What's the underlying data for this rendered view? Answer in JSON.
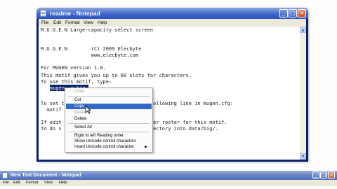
{
  "window": {
    "title": "readme - Notepad",
    "min_label": "_",
    "max_label": "□",
    "close_label": "×"
  },
  "menu": [
    "File",
    "Edit",
    "Format",
    "View",
    "Help"
  ],
  "editor": {
    "lines": [
      "M.U.G.E.N Large-capacity select screen",
      "",
      "M.U.G.E.N        (C) 2009 Elecbyte",
      "                 www.elecbyte.com",
      "",
      "For MUGEN version 1.0.",
      "This motif gives you up to 60 slots for characters.",
      "To use this motif, type:",
      "",
      "",
      "To set t                   , set the following line in mugen.cfg:",
      "  motif",
      "",
      "If edit                   mate character roster for this motif.",
      "To do s                  the data/ directory into data/big/."
    ],
    "selected_text": "mugen -r big"
  },
  "context_menu": {
    "items": [
      {
        "label": "Undo",
        "enabled": false,
        "highlighted": false
      },
      {
        "label": "Cut",
        "enabled": true,
        "highlighted": false
      },
      {
        "label": "Copy",
        "enabled": true,
        "highlighted": true
      },
      {
        "label": "Paste",
        "enabled": false,
        "highlighted": false
      },
      {
        "label": "Delete",
        "enabled": true,
        "highlighted": false
      },
      {
        "label": "Select All",
        "enabled": true,
        "highlighted": false
      },
      {
        "label": "Right to left Reading order",
        "enabled": true,
        "highlighted": false
      },
      {
        "label": "Show Unicode control characters",
        "enabled": true,
        "highlighted": false
      },
      {
        "label": "Insert Unicode control character",
        "enabled": true,
        "highlighted": false,
        "submenu": true
      }
    ],
    "submenu_arrow": "▶"
  },
  "second_window": {
    "title": "New Text Document - Notepad",
    "menu": [
      "File",
      "Edit",
      "Format",
      "View",
      "Help"
    ]
  }
}
